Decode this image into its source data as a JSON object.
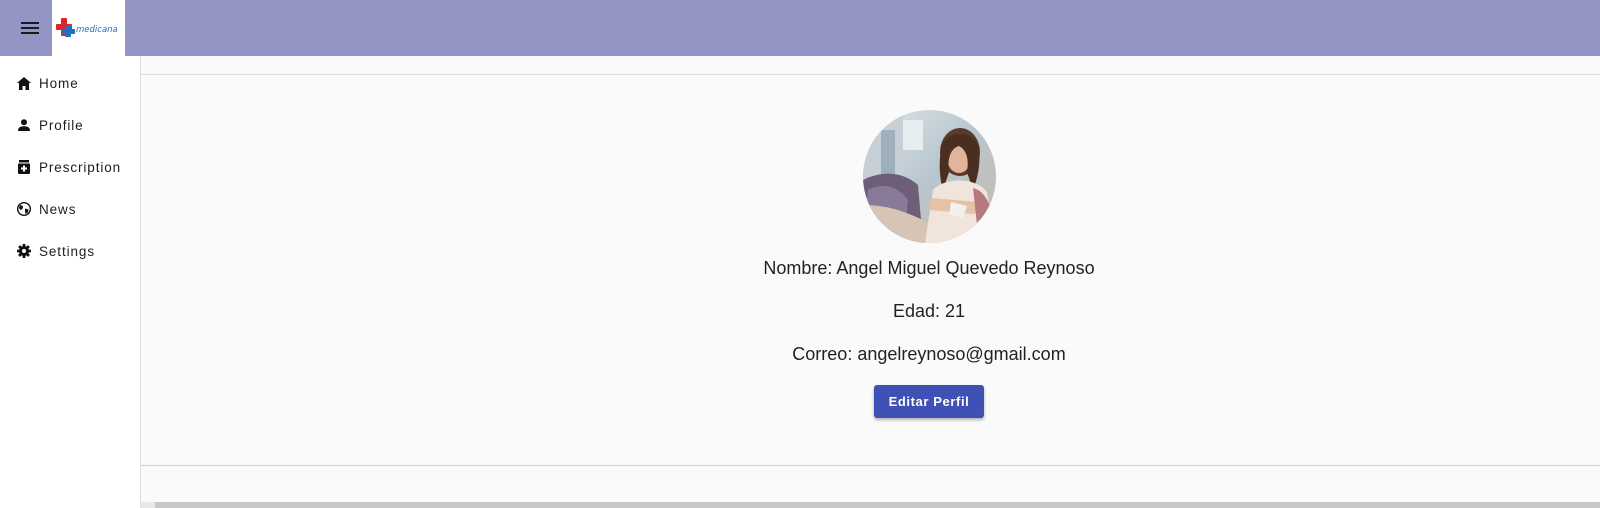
{
  "header": {
    "background": "#9395c4",
    "menu_icon": "hamburger-menu-icon",
    "logo_text": "medicana"
  },
  "sidebar": {
    "items": [
      {
        "label": "Home",
        "icon": "home-icon"
      },
      {
        "label": "Profile",
        "icon": "person-icon"
      },
      {
        "label": "Prescription",
        "icon": "medication-icon"
      },
      {
        "label": "News",
        "icon": "globe-icon"
      },
      {
        "label": "Settings",
        "icon": "gear-icon"
      }
    ]
  },
  "profile": {
    "name": "Nombre: Angel Miguel Quevedo Reynoso",
    "age": "Edad: 21",
    "email": "Correo: angelreynoso@gmail.com",
    "edit_label": "Editar Perfil",
    "button_color": "#3f51b5"
  }
}
